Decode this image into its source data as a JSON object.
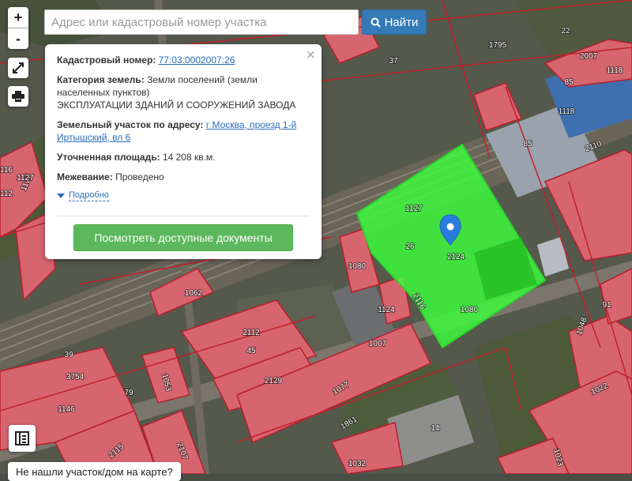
{
  "search": {
    "placeholder": "Адрес или кадастровый номер участка",
    "button_label": "Найти"
  },
  "controls": {
    "zoom_in": "+",
    "zoom_out": "-"
  },
  "popup": {
    "cadastral_label": "Кадастровый номер:",
    "cadastral_value": "77:03:0002007:26",
    "category_label": "Категория земель:",
    "category_value": "Земли поселений (земли населенных пунктов)",
    "category_extra": "ЭКСПЛУАТАЦИИ ЗДАНИЙ И СООРУЖЕНИЙ ЗАВОДА",
    "address_label": "Земельный участок по адресу:",
    "address_value": "г Москва, проезд 1-й Иртышский, вл 6",
    "area_label": "Уточненная площадь:",
    "area_value": "14 208 кв.м.",
    "survey_label": "Межевание:",
    "survey_value": "Проведено",
    "more_label": "Подробно",
    "close_symbol": "×",
    "docs_button": "Посмотреть доступные документы"
  },
  "bottom": {
    "not_found_label": "Не нашли участок/дом на карте?"
  },
  "map": {
    "selected_parcel_color": "#3cff3c",
    "parcel_color": "#e06570",
    "parcel_border_color": "#c0202a",
    "marker_color": "#2b7ce0",
    "parcel_labels": [
      "1795",
      "22",
      "2007",
      "37",
      "85",
      "1118",
      "1118",
      "1127",
      "85",
      "2110",
      "1127",
      "26",
      "2124",
      "1080",
      "1062",
      "1124",
      "2116",
      "1080",
      "2112",
      "1007",
      "45",
      "2129",
      "39",
      "3754",
      "79",
      "1053",
      "1077",
      "1146",
      "1861",
      "1048",
      "91",
      "1022",
      "14",
      "2115",
      "2107",
      "1032",
      "1023",
      "116",
      "112",
      "1127"
    ]
  }
}
